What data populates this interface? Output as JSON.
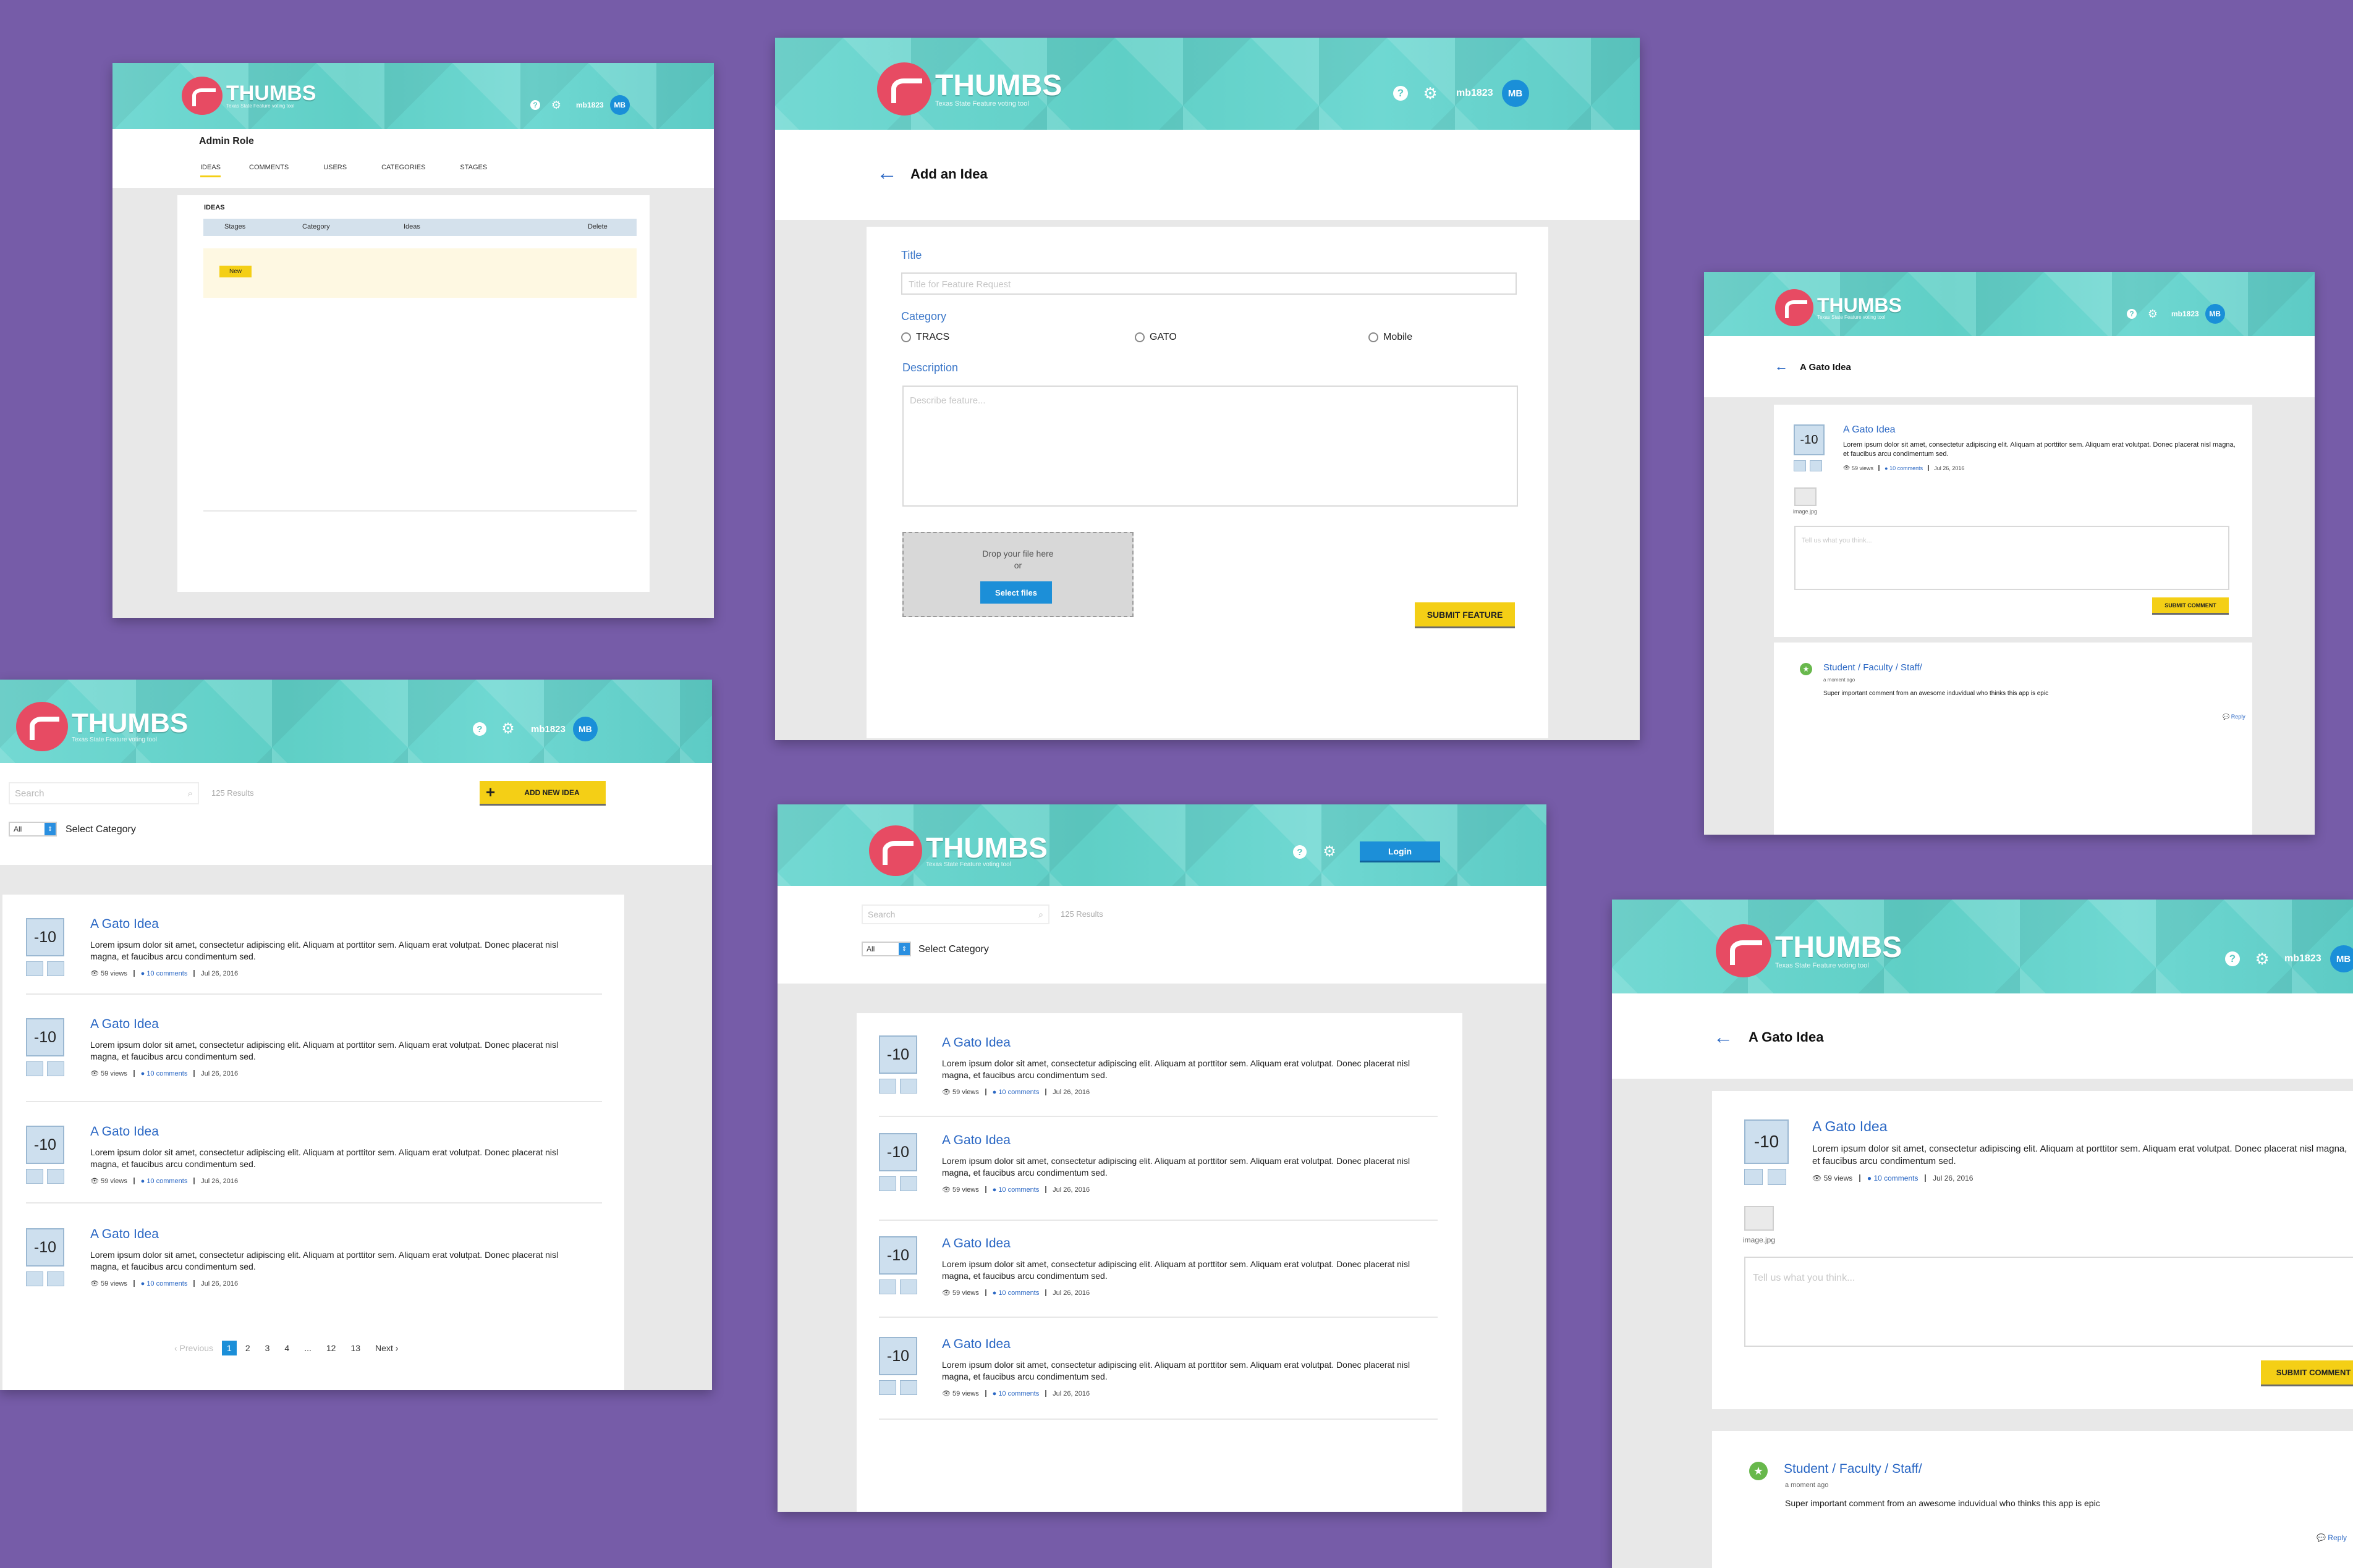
{
  "brand": {
    "title": "THUMBS",
    "tagline": "Texas State Feature voting tool"
  },
  "header": {
    "username": "mb1823",
    "avatar": "MB",
    "help_icon": "?",
    "settings_icon": "gear-icon",
    "login": "Login"
  },
  "colors": {
    "background": "#765ca8",
    "header": "#62d2cd",
    "brand": "#e74b63",
    "link": "#2a67c4",
    "accent": "#f4cf16",
    "button_blue": "#1c8fd8"
  },
  "admin": {
    "heading": "Admin Role",
    "tabs": [
      "IDEAS",
      "COMMENTS",
      "USERS",
      "CATEGORIES",
      "STAGES"
    ],
    "section": "IDEAS",
    "columns": [
      "Stages",
      "Category",
      "Ideas",
      "Delete"
    ],
    "badge": "New"
  },
  "list": {
    "search_placeholder": "Search",
    "results": "125 Results",
    "add_button": "ADD NEW IDEA",
    "filter_value": "All",
    "filter_label": "Select Category",
    "pagination": {
      "prev": "‹ Previous",
      "pages": [
        "1",
        "2",
        "3",
        "4",
        "...",
        "12",
        "13"
      ],
      "next": "Next ›",
      "current": "1"
    }
  },
  "idea": {
    "votes": "-10",
    "title": "A Gato Idea",
    "description": "Lorem ipsum dolor sit amet, consectetur adipiscing elit. Aliquam at porttitor sem.  Aliquam erat volutpat. Donec placerat nisl magna, et faucibus arcu condimentum sed.",
    "views": "59 views",
    "comments": "10 comments",
    "date": "Jul 26, 2016"
  },
  "add_idea": {
    "heading": "Add an Idea",
    "title_label": "Title",
    "title_placeholder": "Title for Feature Request",
    "category_label": "Category",
    "categories": [
      "TRACS",
      "GATO",
      "Mobile"
    ],
    "description_label": "Description",
    "description_placeholder": "Describe feature...",
    "drop_text": "Drop your  file here",
    "drop_or": "or",
    "select_files": "Select files",
    "submit": "SUBMIT FEATURE"
  },
  "detail": {
    "heading": "A Gato Idea",
    "image_caption": "image.jpg",
    "comment_placeholder": "Tell us what you think...",
    "submit_comment": "SUBMIT COMMENT",
    "commenter": "Student / Faculty / Staff/",
    "time": "a moment ago",
    "comment": "Super important comment from an awesome induvidual who thinks this app is epic",
    "reply": "Reply"
  }
}
